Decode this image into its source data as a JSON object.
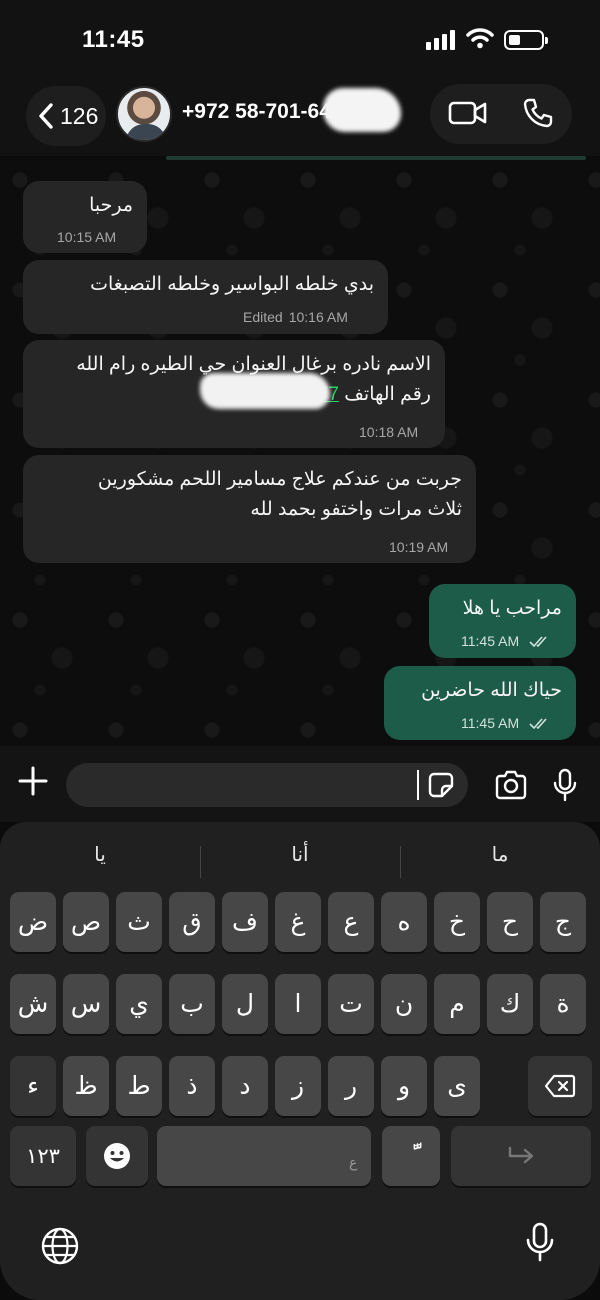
{
  "status_bar": {
    "time": "11:45",
    "battery_fraction": 0.35
  },
  "header": {
    "back_count": "126",
    "contact_phone": "+972 58-701-6413"
  },
  "messages": [
    {
      "dir": "in",
      "text_lines": [
        "مرحبا"
      ],
      "time": "10:15 AM"
    },
    {
      "dir": "in",
      "text_lines": [
        "بدي خلطه البواسير وخلطه التصبغات"
      ],
      "edited_label": "Edited",
      "time": "10:16 AM"
    },
    {
      "dir": "in",
      "text_lines": [
        "الاسم نادره برغال العنوان حي الطيره رام الله",
        "رقم الهاتف"
      ],
      "phone_link": "0599995777",
      "time": "10:18 AM"
    },
    {
      "dir": "in",
      "text_lines": [
        "جربت من عندكم علاج مسامير اللحم مشكورين",
        "ثلاث مرات واختفو بحمد لله"
      ],
      "time": "10:19 AM"
    },
    {
      "dir": "out",
      "text_lines": [
        "مراحب يا هلا"
      ],
      "time": "11:45 AM"
    },
    {
      "dir": "out",
      "text_lines": [
        "حياك الله حاضرين"
      ],
      "time": "11:45 AM"
    }
  ],
  "input": {
    "placeholder": ""
  },
  "keyboard": {
    "suggestions": [
      "يا",
      "أنا",
      "ما"
    ],
    "row1": [
      "ض",
      "ص",
      "ث",
      "ق",
      "ف",
      "غ",
      "ع",
      "ه",
      "خ",
      "ح",
      "ج"
    ],
    "row2": [
      "ش",
      "س",
      "ي",
      "ب",
      "ل",
      "ا",
      "ت",
      "ن",
      "م",
      "ك",
      "ة"
    ],
    "row3": [
      "ء",
      "ظ",
      "ط",
      "ذ",
      "د",
      "ز",
      "ر",
      "و",
      "ى"
    ],
    "numbers_label": "١٢٣",
    "space_hint": "ع",
    "tanween_label": "ًّ"
  },
  "colors": {
    "incoming_bubble": "#262626",
    "outgoing_bubble": "#1d5c48",
    "link": "#25d366"
  },
  "icons": [
    "back-chevron",
    "video-call",
    "phone-call",
    "plus",
    "sticker",
    "camera",
    "microphone",
    "emoji",
    "backspace",
    "return",
    "globe",
    "read-receipt"
  ]
}
